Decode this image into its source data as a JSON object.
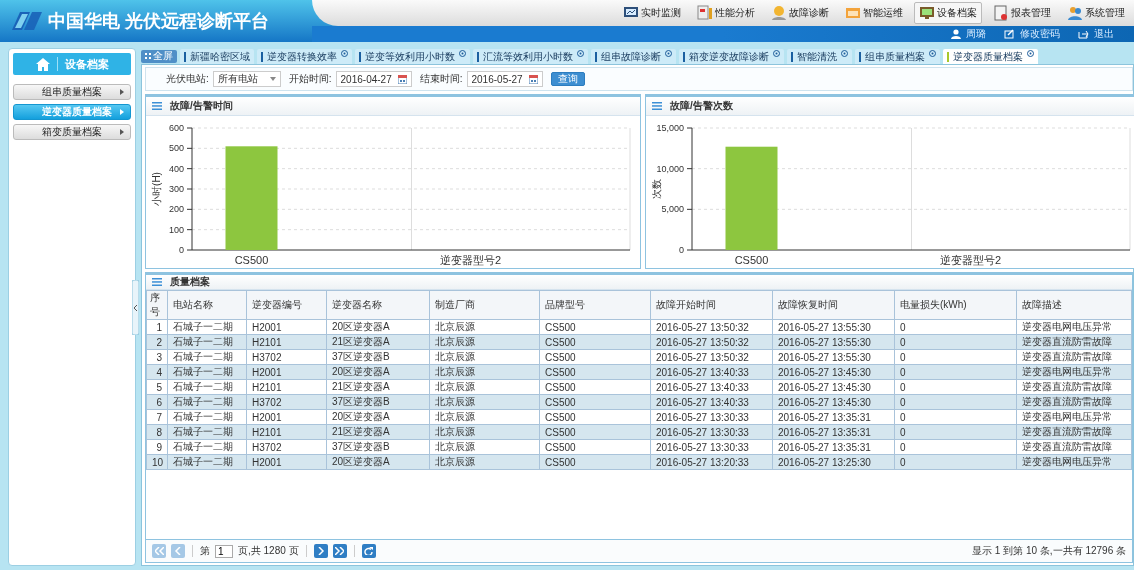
{
  "header": {
    "logo_text": "中国华电 光伏远程诊断平台",
    "nav": [
      {
        "label": "实时监测",
        "selected": false
      },
      {
        "label": "性能分析",
        "selected": false
      },
      {
        "label": "故障诊断",
        "selected": false
      },
      {
        "label": "智能运维",
        "selected": false
      },
      {
        "label": "设备档案",
        "selected": true
      },
      {
        "label": "报表管理",
        "selected": false
      },
      {
        "label": "系统管理",
        "selected": false
      }
    ],
    "user": "周璐",
    "links": [
      "修改密码",
      "退出"
    ]
  },
  "sidebar": {
    "title": "设备档案",
    "items": [
      {
        "label": "组串质量档案",
        "selected": false
      },
      {
        "label": "逆变器质量档案",
        "selected": true
      },
      {
        "label": "箱变质量档案",
        "selected": false
      }
    ]
  },
  "tabs": {
    "fullscreen": "全屏",
    "items": [
      {
        "label": "新疆哈密区域",
        "closable": false,
        "selected": false
      },
      {
        "label": "逆变器转换效率",
        "closable": true,
        "selected": false
      },
      {
        "label": "逆变等效利用小时数",
        "closable": true,
        "selected": false
      },
      {
        "label": "汇流等效利用小时数",
        "closable": true,
        "selected": false
      },
      {
        "label": "组串故障诊断",
        "closable": true,
        "selected": false
      },
      {
        "label": "箱变逆变故障诊断",
        "closable": true,
        "selected": false
      },
      {
        "label": "智能清洗",
        "closable": true,
        "selected": false
      },
      {
        "label": "组串质量档案",
        "closable": true,
        "selected": false
      },
      {
        "label": "逆变器质量档案",
        "closable": true,
        "selected": true
      }
    ]
  },
  "filter": {
    "station_label": "光伏电站:",
    "station_value": "所有电站",
    "start_label": "开始时间:",
    "start_value": "2016-04-27",
    "end_label": "结束时间:",
    "end_value": "2016-05-27",
    "query_button": "查询"
  },
  "charts": [
    {
      "title": "故障/告警时间",
      "chart_data": {
        "type": "bar",
        "ylabel": "小时(H)",
        "categories": [
          "CS500",
          "逆变器型号2"
        ],
        "series": [
          {
            "color": "#8dc63f",
            "values": [
              510,
              null
            ]
          }
        ],
        "grid": true,
        "ylim": [
          0,
          600
        ],
        "yticks": [
          0,
          100,
          200,
          300,
          400,
          500,
          600
        ]
      }
    },
    {
      "title": "故障/告警次数",
      "chart_data": {
        "type": "bar",
        "ylabel": "次数",
        "categories": [
          "CS500",
          "逆变器型号2"
        ],
        "series": [
          {
            "color": "#8dc63f",
            "values": [
              12700,
              null
            ]
          }
        ],
        "grid": true,
        "ylim": [
          0,
          15000
        ],
        "yticks": [
          {
            "value": 0,
            "label": "0"
          },
          {
            "value": 5000,
            "label": "5,000"
          },
          {
            "value": 10000,
            "label": "10,000"
          },
          {
            "value": 15000,
            "label": "15,000"
          }
        ]
      }
    }
  ],
  "table": {
    "title": "质量档案",
    "columns": [
      "序号",
      "电站名称",
      "逆变器编号",
      "逆变器名称",
      "制造厂商",
      "品牌型号",
      "故障开始时间",
      "故障恢复时间",
      "电量损失(kWh)",
      "故障描述"
    ],
    "rows": [
      [
        "1",
        "石城子一二期",
        "H2001",
        "20区逆变器A",
        "北京辰源",
        "CS500",
        "2016-05-27 13:50:32",
        "2016-05-27 13:55:30",
        "0",
        "逆变器电网电压异常"
      ],
      [
        "2",
        "石城子一二期",
        "H2101",
        "21区逆变器A",
        "北京辰源",
        "CS500",
        "2016-05-27 13:50:32",
        "2016-05-27 13:55:30",
        "0",
        "逆变器直流防雷故障"
      ],
      [
        "3",
        "石城子一二期",
        "H3702",
        "37区逆变器B",
        "北京辰源",
        "CS500",
        "2016-05-27 13:50:32",
        "2016-05-27 13:55:30",
        "0",
        "逆变器直流防雷故障"
      ],
      [
        "4",
        "石城子一二期",
        "H2001",
        "20区逆变器A",
        "北京辰源",
        "CS500",
        "2016-05-27 13:40:33",
        "2016-05-27 13:45:30",
        "0",
        "逆变器电网电压异常"
      ],
      [
        "5",
        "石城子一二期",
        "H2101",
        "21区逆变器A",
        "北京辰源",
        "CS500",
        "2016-05-27 13:40:33",
        "2016-05-27 13:45:30",
        "0",
        "逆变器直流防雷故障"
      ],
      [
        "6",
        "石城子一二期",
        "H3702",
        "37区逆变器B",
        "北京辰源",
        "CS500",
        "2016-05-27 13:40:33",
        "2016-05-27 13:45:30",
        "0",
        "逆变器直流防雷故障"
      ],
      [
        "7",
        "石城子一二期",
        "H2001",
        "20区逆变器A",
        "北京辰源",
        "CS500",
        "2016-05-27 13:30:33",
        "2016-05-27 13:35:31",
        "0",
        "逆变器电网电压异常"
      ],
      [
        "8",
        "石城子一二期",
        "H2101",
        "21区逆变器A",
        "北京辰源",
        "CS500",
        "2016-05-27 13:30:33",
        "2016-05-27 13:35:31",
        "0",
        "逆变器直流防雷故障"
      ],
      [
        "9",
        "石城子一二期",
        "H3702",
        "37区逆变器B",
        "北京辰源",
        "CS500",
        "2016-05-27 13:30:33",
        "2016-05-27 13:35:31",
        "0",
        "逆变器直流防雷故障"
      ],
      [
        "10",
        "石城子一二期",
        "H2001",
        "20区逆变器A",
        "北京辰源",
        "CS500",
        "2016-05-27 13:20:33",
        "2016-05-27 13:25:30",
        "0",
        "逆变器电网电压异常"
      ]
    ]
  },
  "pager": {
    "first_disabled": true,
    "prev_disabled": true,
    "page_label": "第",
    "page_value": "1",
    "total_pages": "页,共 1280 页",
    "info": "显示 1 到第 10 条,一共有 12796 条"
  }
}
